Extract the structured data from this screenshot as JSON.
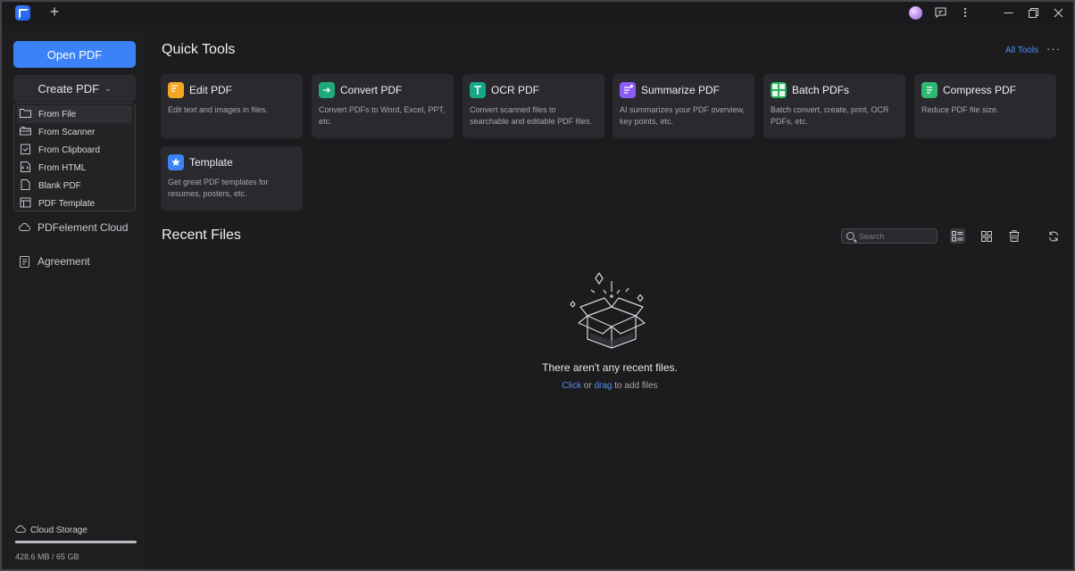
{
  "titlebar": {
    "new_tab": "+",
    "icons": [
      "app-logo-icon",
      "plus-icon",
      "avatar",
      "message-icon",
      "more-vertical-icon",
      "minimize-icon",
      "restore-icon",
      "close-icon"
    ]
  },
  "sidebar": {
    "open_pdf": "Open PDF",
    "create_pdf": "Create PDF",
    "create_menu": [
      {
        "label": "From File",
        "icon": "folder-icon",
        "active": true
      },
      {
        "label": "From Scanner",
        "icon": "scanner-icon",
        "active": false
      },
      {
        "label": "From Clipboard",
        "icon": "clipboard-icon",
        "active": false
      },
      {
        "label": "From HTML",
        "icon": "html-icon",
        "active": false
      },
      {
        "label": "Blank PDF",
        "icon": "blank-page-icon",
        "active": false
      },
      {
        "label": "PDF Template",
        "icon": "template-icon",
        "active": false
      }
    ],
    "cloud": "PDFelement Cloud",
    "agreement": "Agreement",
    "storage": {
      "label": "Cloud Storage",
      "size": "428.6 MB / 65 GB",
      "used_fraction": 0.0066
    }
  },
  "quick_tools": {
    "title": "Quick Tools",
    "all_tools": "All Tools",
    "more": "···",
    "tools": [
      {
        "title": "Edit PDF",
        "desc": "Edit text and images in files.",
        "icon": "edit-pdf-icon",
        "color": "#f5a623"
      },
      {
        "title": "Convert PDF",
        "desc": "Convert PDFs to Word, Excel, PPT, etc.",
        "icon": "convert-pdf-icon",
        "color": "#1fa97a"
      },
      {
        "title": "OCR PDF",
        "desc": "Convert scanned files to searchable and editable PDF files.",
        "icon": "ocr-pdf-icon",
        "color": "#17a889"
      },
      {
        "title": "Summarize PDF",
        "desc": "AI summarizes your PDF overview, key points, etc.",
        "icon": "summarize-pdf-icon",
        "color": "#8b5cf6"
      },
      {
        "title": "Batch PDFs",
        "desc": "Batch convert, create, print, OCR PDFs, etc.",
        "icon": "batch-pdfs-icon",
        "color": "#22b35e"
      },
      {
        "title": "Compress PDF",
        "desc": "Reduce PDF file size.",
        "icon": "compress-pdf-icon",
        "color": "#2eb872"
      },
      {
        "title": "Template",
        "desc": "Get great PDF templates for resumes, posters, etc.",
        "icon": "template-icon",
        "color": "#3b82f6"
      }
    ]
  },
  "recent_files": {
    "title": "Recent Files",
    "search_placeholder": "Search",
    "empty_title": "There aren't any recent files.",
    "empty_click": "Click",
    "empty_or": " or ",
    "empty_drag": "drag",
    "empty_rest": " to add files"
  }
}
